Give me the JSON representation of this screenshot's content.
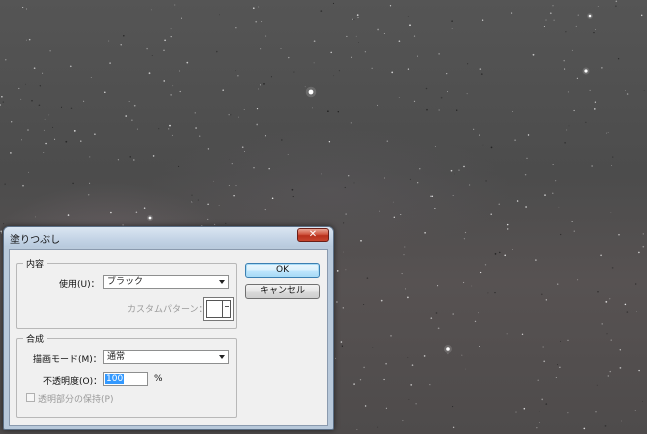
{
  "dialog": {
    "title": "塗りつぶし",
    "close_label": "✕",
    "content_group": {
      "label": "内容",
      "use_label": "使用(U)：",
      "use_value": "ブラック",
      "custom_pattern_label": "カスタムパターン："
    },
    "blend_group": {
      "label": "合成",
      "mode_label": "描画モード(M)：",
      "mode_value": "通常",
      "opacity_label": "不透明度(O)：",
      "opacity_value": "100",
      "opacity_unit": "%",
      "preserve_transparency_label": "透明部分の保持(P)"
    },
    "ok_label": "OK",
    "cancel_label": "キャンセル"
  },
  "colors": {
    "background": "#4a4a4a",
    "dialog_frame": "#b9cadc",
    "close_button": "#c6452e",
    "selection": "#3399ff"
  }
}
